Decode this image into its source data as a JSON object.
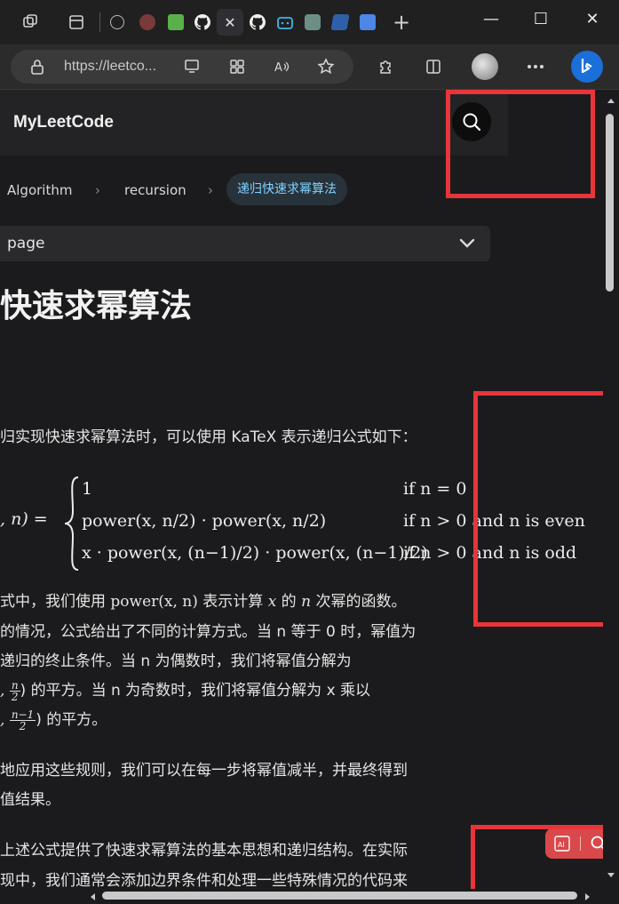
{
  "browser": {
    "url": "https://leetco...",
    "tab_close_glyph": "✕",
    "new_tab_glyph": "+",
    "window": {
      "minimize": "—",
      "maximize": "☐",
      "close": "✕"
    },
    "toolbar_icons": [
      "lock-icon",
      "app-available-icon",
      "apps-icon",
      "read-aloud-icon",
      "favorite-star-icon",
      "extensions-icon",
      "split-screen-icon",
      "profile-avatar",
      "more-icon",
      "bing-icon"
    ],
    "read_aloud_label": "A̸⁾"
  },
  "site": {
    "title": "MyLeetCode"
  },
  "breadcrumb": {
    "items": [
      "Algorithm",
      "recursion"
    ],
    "current": "递归快速求幂算法",
    "separator": "›"
  },
  "on_this_page": {
    "label": "page"
  },
  "article": {
    "heading": "快速求幂算法",
    "intro": "归实现快速求幂算法时，可以使用 KaTeX 表示递归公式如下：",
    "formula": {
      "lhs": ", n) =",
      "cases": [
        {
          "value": "1",
          "cond": "if n = 0"
        },
        {
          "value": "power(x, n/2) · power(x, n/2)",
          "cond": "if n > 0 and n is even"
        },
        {
          "value": "x · power(x, (n−1)/2) · power(x, (n−1)/2)",
          "cond": "if n > 0 and n is odd"
        }
      ]
    },
    "p1_line1_a": "式中，我们使用 ",
    "p1_line1_math": "power(x, n)",
    "p1_line1_b": " 表示计算 ",
    "p1_line1_x": "x",
    "p1_line1_c": " 的 ",
    "p1_line1_n": "n",
    "p1_line1_d": " 次幂的函数。",
    "p1_line2": "的情况，公式给出了不同的计算方式。当 n 等于 0 时，幂值为",
    "p1_line3": "递归的终止条件。当 n 为偶数时，我们将幂值分解为",
    "p1_line4_a": ", ",
    "p1_line4_b": ") 的平方。当 n 为奇数时，我们将幂值分解为 x 乘以",
    "p1_line5_a": ", ",
    "p1_line5_b": ") 的平方。",
    "p2_line1": "地应用这些规则，我们可以在每一步将幂值减半，并最终得到",
    "p2_line2": "值结果。",
    "p3_line1": "上述公式提供了快速求幂算法的基本思想和递归结构。在实际",
    "p3_line2": "现中，我们通常会添加边界条件和处理一些特殊情况的代码来"
  },
  "widget": {
    "icons": [
      "ai-icon",
      "search-icon"
    ]
  },
  "colors": {
    "annotation": "#e8353a",
    "link_highlight": "#7fd3ff",
    "widget": "#d9484a"
  }
}
